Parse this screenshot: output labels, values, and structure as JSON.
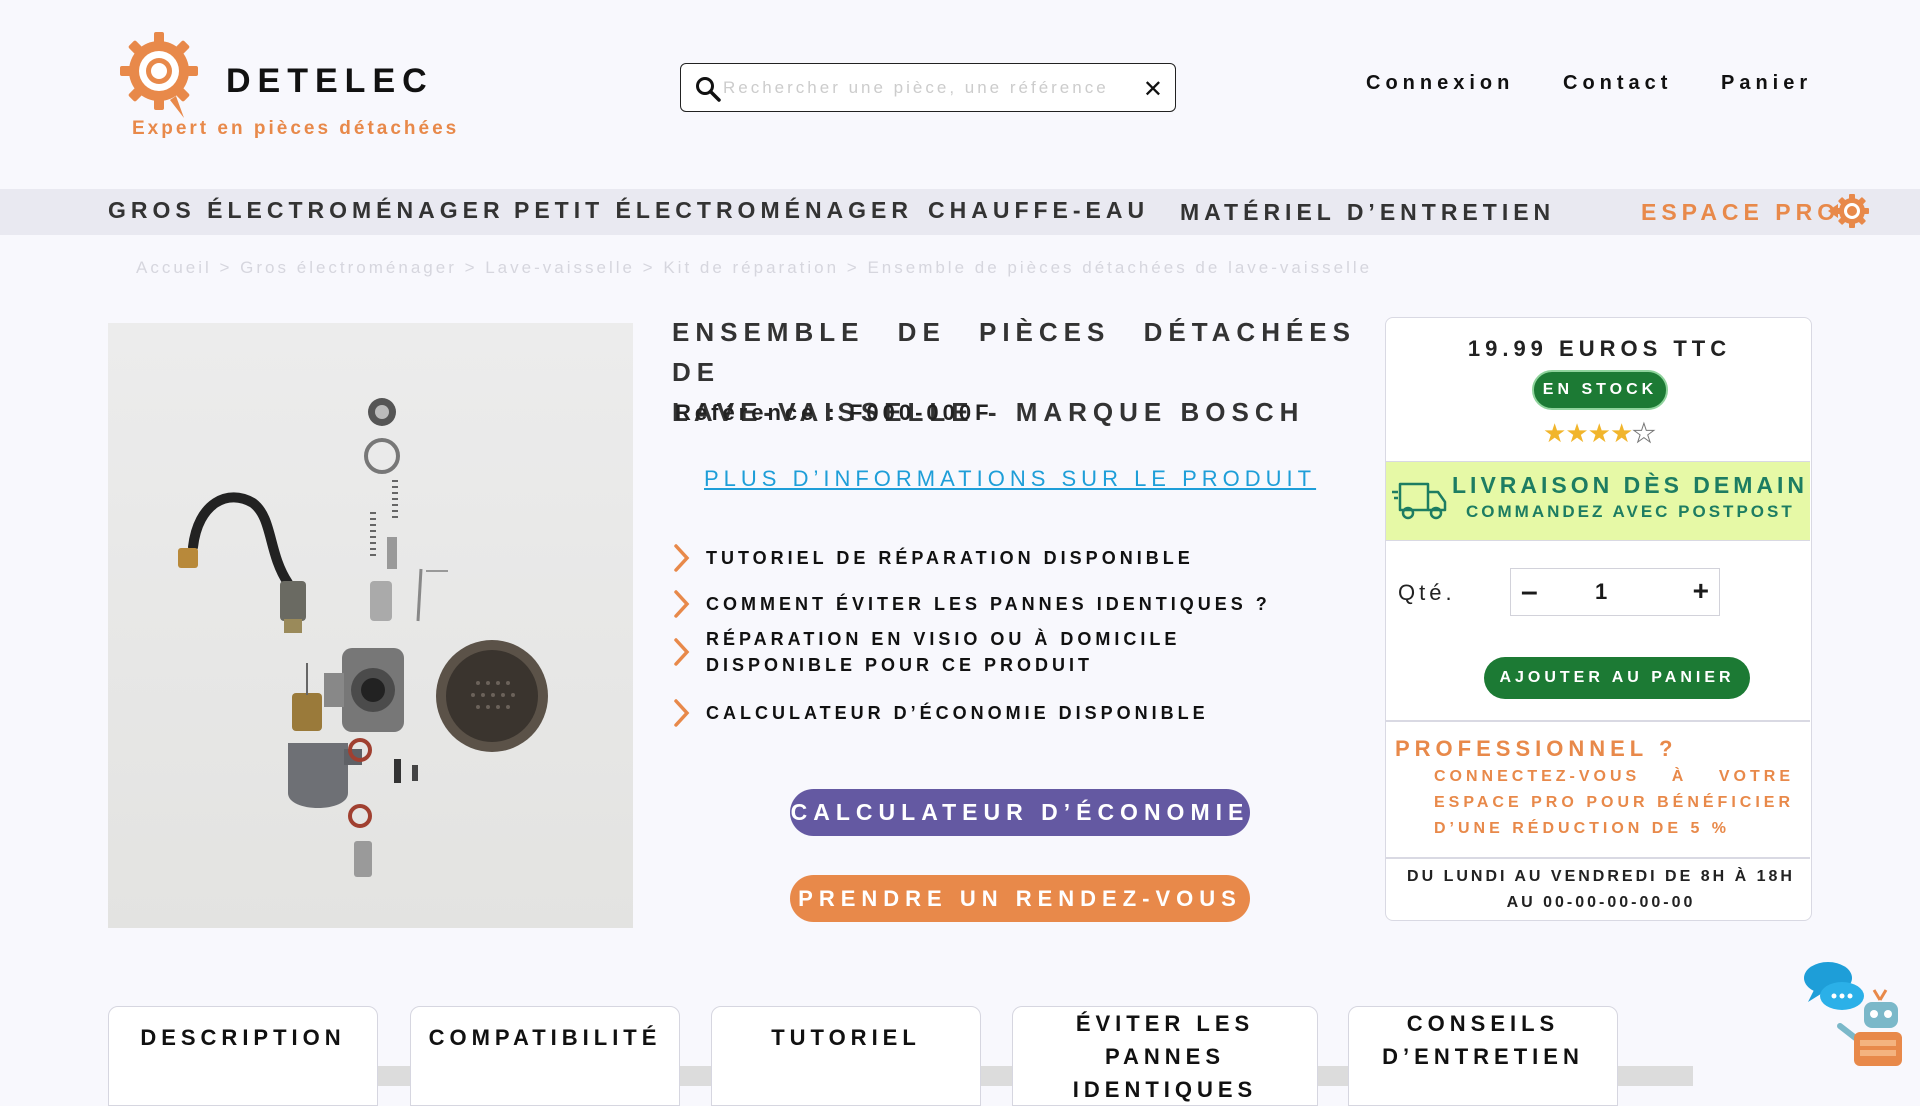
{
  "header": {
    "brand": "DETELEC",
    "tagline": "Expert en pièces détachées",
    "search": {
      "placeholder": "Rechercher une pièce, une référence"
    },
    "links": {
      "login": "Connexion",
      "contact": "Contact",
      "cart": "Panier"
    }
  },
  "nav": {
    "items": [
      "GROS ÉLECTROMÉNAGER",
      "PETIT ÉLECTROMÉNAGER",
      "CHAUFFE-EAU",
      "MATÉRIEL D’ENTRETIEN"
    ],
    "pro": "ESPACE PRO"
  },
  "breadcrumb": "Accueil > Gros électroménager > Lave-vaisselle > Kit de réparation > Ensemble de pièces détachées de lave-vaisselle",
  "product": {
    "title_line1": "ENSEMBLE DE PIÈCES DÉTACHÉES DE",
    "title_line2": "LAVE-VAISSELLE - MARQUE BOSCH",
    "reference": "Référence : F000-000F",
    "more_info": "PLUS D’INFORMATIONS SUR LE PRODUIT",
    "features": [
      "TUTORIEL DE RÉPARATION DISPONIBLE",
      "COMMENT ÉVITER LES PANNES IDENTIQUES ?",
      "RÉPARATION EN VISIO OU À DOMICILE DISPONIBLE POUR CE PRODUIT",
      "CALCULATEUR D’ÉCONOMIE DISPONIBLE"
    ],
    "btn_calc": "CALCULATEUR D’ÉCONOMIE",
    "btn_rdv": "PRENDRE UN RENDEZ-VOUS"
  },
  "purchase": {
    "price": "19.99 EUROS TTC",
    "stock": "EN STOCK",
    "rating": 4,
    "rating_max": 5,
    "delivery_title": "LIVRAISON DÈS DEMAIN",
    "delivery_sub": "COMMANDEZ AVEC POSTPOST",
    "qty_label": "Qté.",
    "qty_value": "1",
    "qty_minus": "–",
    "qty_plus": "+",
    "add_to_cart": "AJOUTER AU PANIER",
    "pro_title": "PROFESSIONNEL ?",
    "pro_text": "CONNECTEZ-VOUS À VOTRE ESPACE PRO POUR BÉNÉFICIER D’UNE RÉDUCTION DE 5 %",
    "hours": "DU LUNDI AU VENDREDI DE 8H À 18H AU 00-00-00-00-00"
  },
  "tabs": [
    "DESCRIPTION",
    "COMPATIBILITÉ",
    "TUTORIEL",
    "ÉVITER LES PANNES IDENTIQUES",
    "CONSEILS D’ENTRETIEN"
  ],
  "colors": {
    "accent_orange": "#e8894a",
    "green": "#1c7a34",
    "purple": "#6459a2",
    "link_blue": "#1e9ed8",
    "delivery_bg": "#e6f9a6"
  },
  "icons": [
    "gear-logo-icon",
    "search-icon",
    "close-icon",
    "gear-icon",
    "chevron-right-icon",
    "star-icon",
    "delivery-truck-icon",
    "chatbot-icon"
  ]
}
